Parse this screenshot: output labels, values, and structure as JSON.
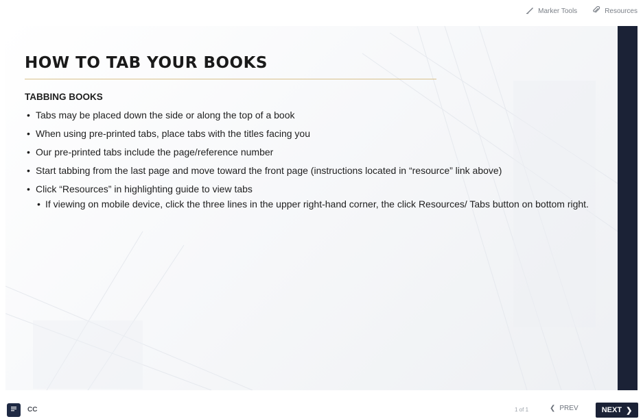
{
  "topbar": {
    "marker_tools_label": "Marker Tools",
    "resources_label": "Resources"
  },
  "slide": {
    "title": "HOW TO TAB YOUR BOOKS",
    "subtitle": "TABBING BOOKS",
    "bullets": [
      "Tabs may be placed down the side or along the top of a book",
      "When using pre-printed tabs, place tabs with the titles facing you",
      "Our pre-printed tabs include the page/reference number",
      "Start tabbing from the last page and move toward the front page (instructions located in “resource” link above)",
      "Click “Resources” in highlighting guide to view tabs"
    ],
    "sub_bullets": [
      "If viewing on mobile device, click the three lines in the upper right-hand corner, the click Resources/ Tabs button on bottom right."
    ]
  },
  "footer": {
    "cc_label": "CC",
    "counter": "1 of 1",
    "prev_label": "PREV",
    "next_label": "NEXT"
  },
  "colors": {
    "accent_dark": "#1b2236",
    "rule": "#d8c08a"
  },
  "icons": {
    "marker_tools": "marker-icon",
    "resources": "paperclip-icon",
    "menu": "menu-icon",
    "prev": "chevron-left-icon",
    "next": "chevron-right-icon"
  }
}
